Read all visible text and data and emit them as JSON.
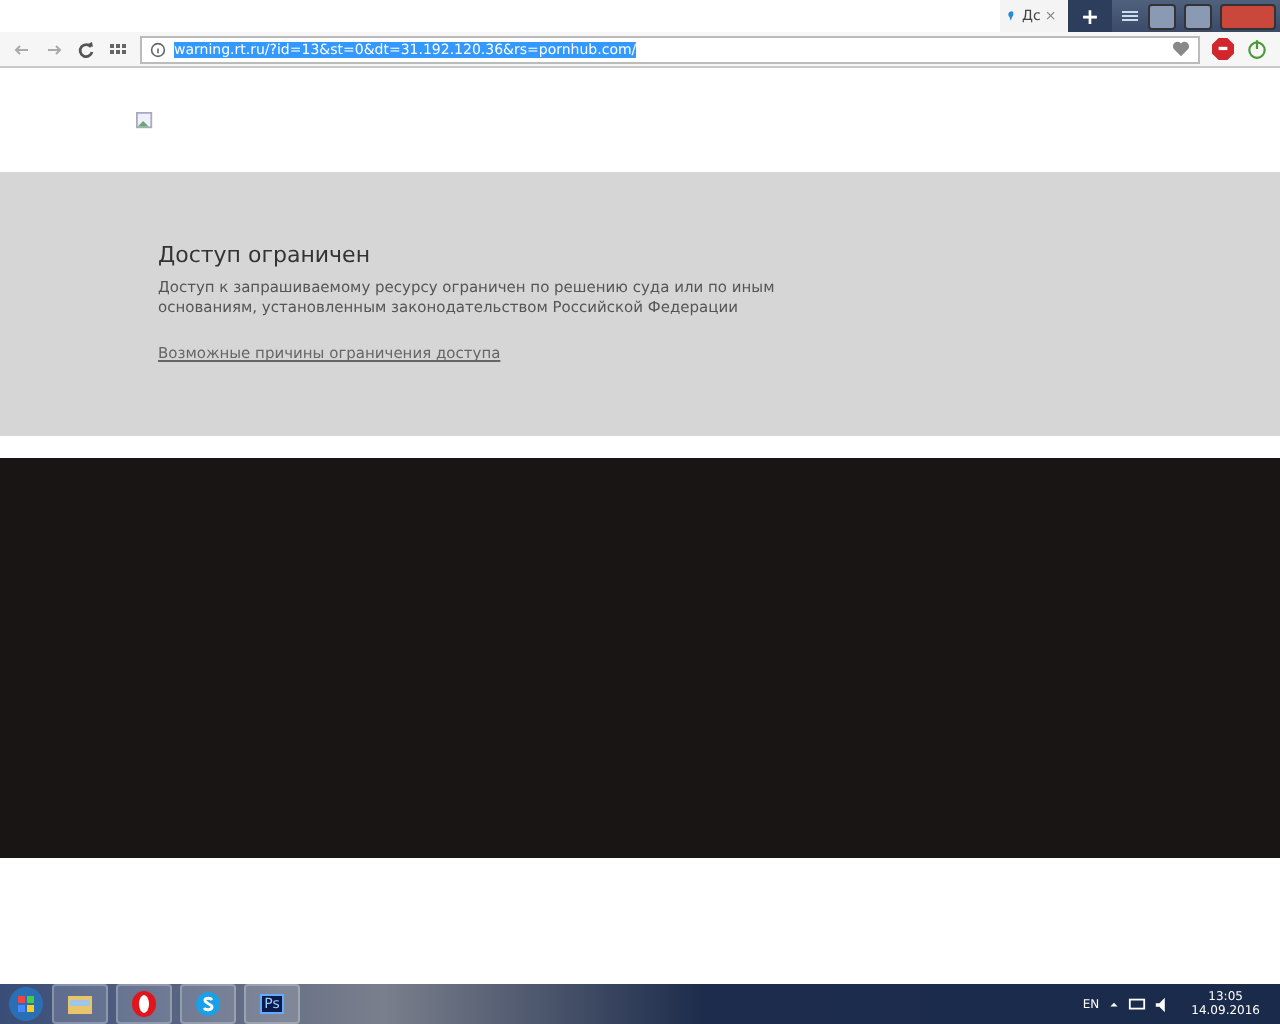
{
  "tab": {
    "title": "Дс",
    "close": "×",
    "selected": true
  },
  "new_tab": "+",
  "address_bar": {
    "value": "warning.rt.ru/?id=13&st=0&dt=31.192.120.36&rs=pornhub.com/",
    "selected": true
  },
  "notice": {
    "title": "Доступ ограничен",
    "text": "Доступ к запрашиваемому ресурсу ограничен по решению суда или по иным основаниям, установленным законодательством Российской Федерации",
    "link": "Возможные причины ограничения доступа"
  },
  "taskbar": {
    "apps": [
      {
        "kind": "folder"
      },
      {
        "kind": "opera"
      },
      {
        "kind": "skype"
      },
      {
        "kind": "photoshop",
        "label": "Ps"
      }
    ],
    "language": "EN",
    "time": "13:05",
    "date": "14.09.2016"
  }
}
